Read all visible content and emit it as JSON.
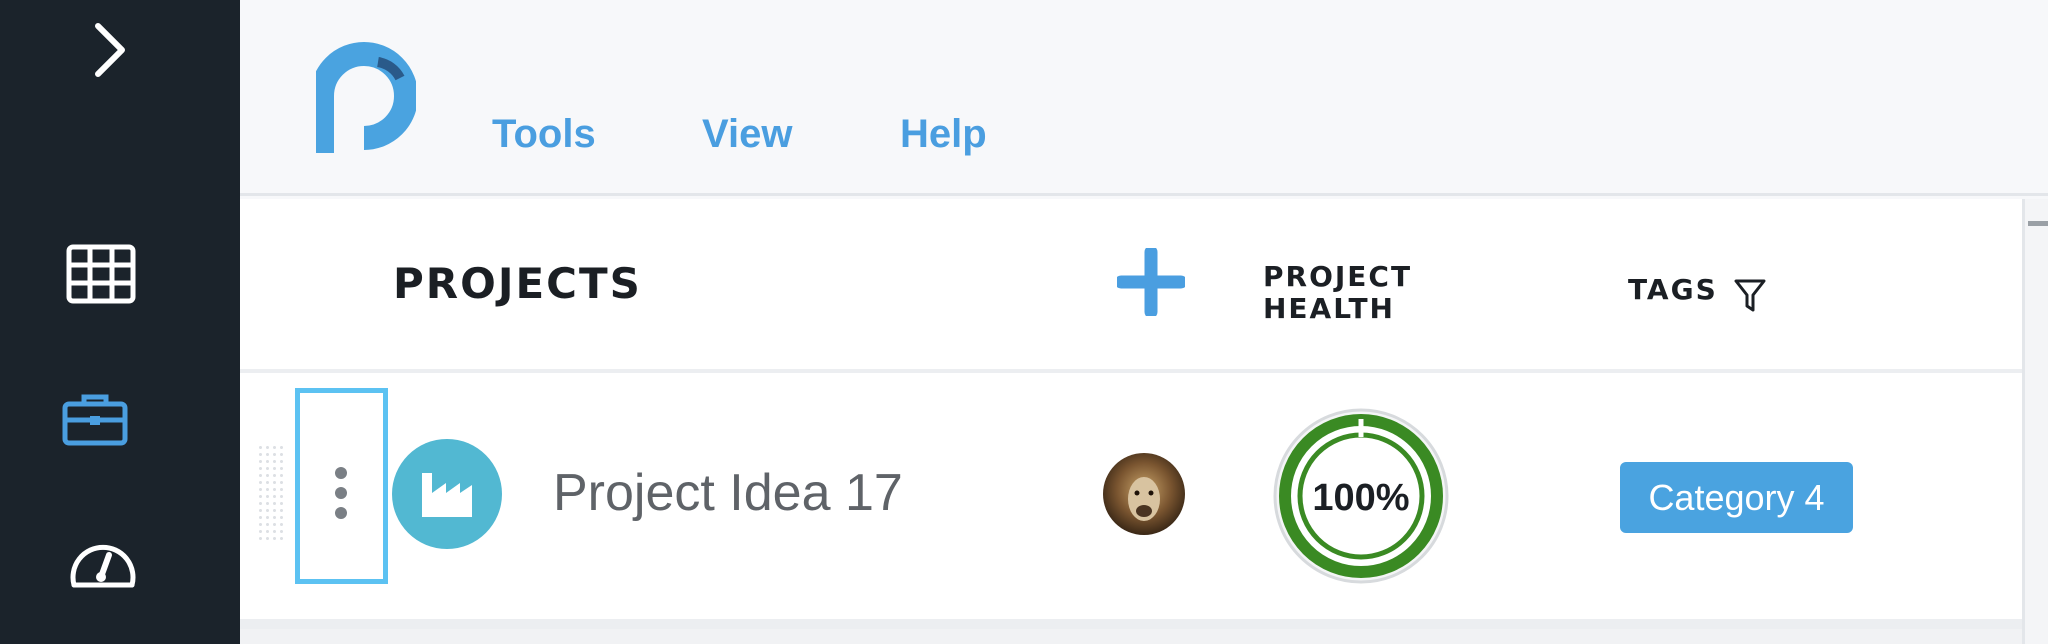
{
  "sidebar": {
    "items": [
      {
        "icon": "chevron-right-icon"
      },
      {
        "icon": "grid-icon"
      },
      {
        "icon": "briefcase-icon",
        "active": true
      },
      {
        "icon": "dashboard-gauge-icon"
      }
    ],
    "colors": {
      "background": "#1b232b",
      "icon": "#ffffff",
      "active": "#4a9ee0"
    }
  },
  "header": {
    "logo_icon": "app-logo-icon",
    "menu": [
      {
        "label": "Tools"
      },
      {
        "label": "View"
      },
      {
        "label": "Help"
      }
    ]
  },
  "table": {
    "columns": {
      "projects": "PROJECTS",
      "health_line1": "PROJECT",
      "health_line2": "HEALTH",
      "tags": "TAGS"
    },
    "add_icon": "plus-icon",
    "filter_icon": "filter-icon",
    "rows": [
      {
        "menu_icon": "vertical-ellipsis-icon",
        "type_icon": "factory-icon",
        "name": "Project Idea 17",
        "owner_avatar": "lion-avatar",
        "health_percent": 100,
        "health_label": "100%",
        "tag": "Category 4"
      }
    ]
  },
  "colors": {
    "accent": "#4a9ee0",
    "health": "#3a8a23",
    "tag": "#4aa3e0",
    "selection": "#5cc2f2"
  }
}
